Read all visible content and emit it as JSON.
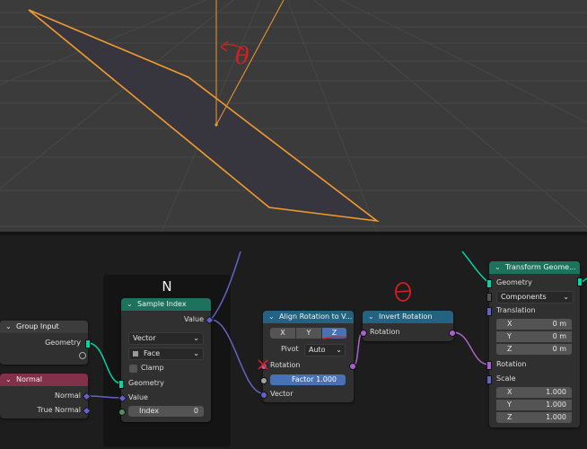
{
  "viewport": {
    "annotation_symbol": "θ",
    "colors": {
      "background": "#3b3b3b",
      "grid": "#474747",
      "plane_fill": "#37353d",
      "selection": "#f29a30",
      "annotation": "#d42020"
    }
  },
  "frame": {
    "label": "N"
  },
  "nodes": {
    "group_input": {
      "title": "Group Input",
      "outputs": [
        "Geometry"
      ]
    },
    "normal": {
      "title": "Normal",
      "outputs": [
        "Normal",
        "True Normal"
      ]
    },
    "sample_index": {
      "title": "Sample Index",
      "output": "Value",
      "data_type": "Vector",
      "domain": "Face",
      "clamp_label": "Clamp",
      "inputs": {
        "geometry": "Geometry",
        "value": "Value"
      },
      "index": {
        "label": "Index",
        "value": "0"
      }
    },
    "align_rotation": {
      "title": "Align Rotation to V...",
      "axes": [
        "X",
        "Y",
        "Z"
      ],
      "selected_axis": "Z",
      "pivot_label": "Pivot",
      "pivot_value": "Auto",
      "inputs": {
        "rotation": "Rotation",
        "vector": "Vector"
      },
      "factor": {
        "label": "Factor",
        "value": "1.000"
      }
    },
    "invert_rotation": {
      "title": "Invert Rotation",
      "socket": "Rotation"
    },
    "transform_geometry": {
      "title": "Transform Geome...",
      "output": "Geometry",
      "input_geometry": "Geometry",
      "mode": "Components",
      "translation": {
        "label": "Translation",
        "x": {
          "axis": "X",
          "value": "0 m"
        },
        "y": {
          "axis": "Y",
          "value": "0 m"
        },
        "z": {
          "axis": "Z",
          "value": "0 m"
        }
      },
      "rotation_label": "Rotation",
      "scale": {
        "label": "Scale",
        "x": {
          "axis": "X",
          "value": "1.000"
        },
        "y": {
          "axis": "Y",
          "value": "1.000"
        },
        "z": {
          "axis": "Z",
          "value": "1.000"
        }
      }
    }
  },
  "annotations": {
    "node_theta": "θ"
  },
  "icons": [
    "chevron-down-icon",
    "dropdown-arrow-icon",
    "socket-circle-icon",
    "socket-diamond-icon"
  ],
  "colors": {
    "geometry_socket": "#00d6a3",
    "vector_socket": "#6363c7",
    "rotation_socket": "#a663c7",
    "float_socket": "#a1a1a1",
    "int_socket": "#598c5c",
    "header_green": "#1d725e",
    "header_blue": "#246283",
    "header_red": "#83314a",
    "header_dark": "#3c3c3c",
    "active_field": "#4772b3"
  }
}
